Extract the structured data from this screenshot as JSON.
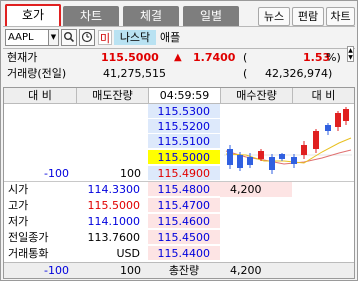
{
  "tabs": [
    {
      "label": "호가",
      "active": true
    },
    {
      "label": "차트",
      "active": false
    },
    {
      "label": "체결",
      "active": false
    },
    {
      "label": "일별",
      "active": false
    }
  ],
  "toolbar": {
    "news": "뉴스",
    "edit": "편람",
    "chart": "차트"
  },
  "symbol": {
    "code": "AAPL",
    "market_mark": "미",
    "market": "나스닥",
    "name": "애플"
  },
  "quote": {
    "current_label": "현재가",
    "price": "115.5000",
    "change_arrow": "▲",
    "change": "1.7400",
    "rate_open": "(",
    "rate": "1.53",
    "rate_close": "%)",
    "volume_label": "거래량(전일)",
    "volume": "41,275,515",
    "prev_open": "(",
    "prev_volume": "42,326,974)"
  },
  "orderbook_header": {
    "diff_left": "대  비",
    "ask_qty": "매도잔량",
    "time": "04:59:59",
    "bid_qty": "매수잔량",
    "diff_right": "대  비"
  },
  "asks": [
    "115.5300",
    "115.5200",
    "115.5100",
    "115.5000",
    "115.4900"
  ],
  "ask_row": {
    "diff": "-100",
    "qty": "100"
  },
  "bids": [
    "115.4800",
    "115.4700",
    "115.4600",
    "115.4500",
    "115.4400"
  ],
  "bid_qty_first": "4,200",
  "info": [
    {
      "label": "시가",
      "value": "114.3300"
    },
    {
      "label": "고가",
      "value": "115.5000"
    },
    {
      "label": "저가",
      "value": "114.1000"
    },
    {
      "label": "전일종가",
      "value": "113.7600"
    },
    {
      "label": "거래통화",
      "value": "USD"
    }
  ],
  "totals": {
    "diff": "-100",
    "ask_total": "100",
    "label": "총잔량",
    "bid_total": "4,200"
  },
  "colors": {
    "up": "#e00000",
    "down": "#0000dd",
    "highlight": "#ffff00",
    "ask_bg": "#dde9fb",
    "bid_bg": "#fde4e4"
  },
  "icons": [
    "search-icon",
    "clock-icon",
    "chevron-down-icon",
    "edit-icon"
  ]
}
